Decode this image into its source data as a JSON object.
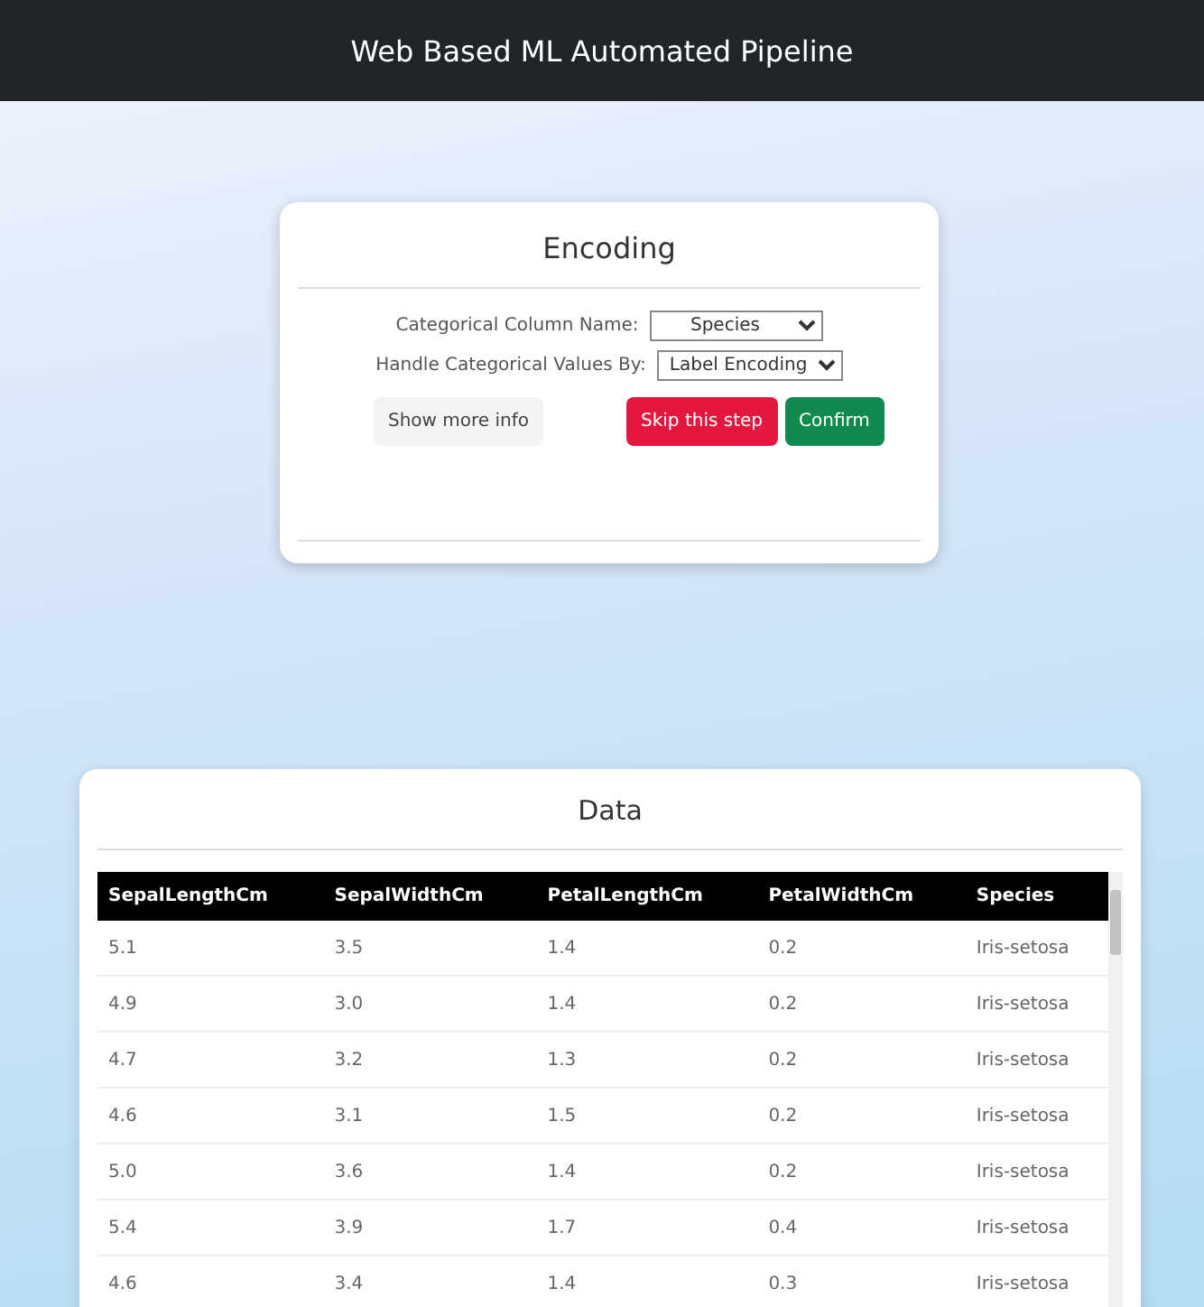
{
  "header": {
    "title": "Web Based ML Automated Pipeline"
  },
  "encoding_card": {
    "title": "Encoding",
    "fields": [
      {
        "label": "Categorical Column Name:",
        "value": "Species"
      },
      {
        "label": "Handle Categorical Values By:",
        "value": "Label Encoding"
      }
    ],
    "buttons": [
      {
        "label": "Show more info",
        "kind": "light"
      },
      {
        "label": "Skip this step",
        "kind": "danger"
      },
      {
        "label": "Confirm",
        "kind": "success"
      }
    ]
  },
  "data_card": {
    "title": "Data",
    "table": {
      "columns": [
        "SepalLengthCm",
        "SepalWidthCm",
        "PetalLengthCm",
        "PetalWidthCm",
        "Species"
      ],
      "rows": [
        [
          "5.1",
          "3.5",
          "1.4",
          "0.2",
          "Iris-setosa"
        ],
        [
          "4.9",
          "3.0",
          "1.4",
          "0.2",
          "Iris-setosa"
        ],
        [
          "4.7",
          "3.2",
          "1.3",
          "0.2",
          "Iris-setosa"
        ],
        [
          "4.6",
          "3.1",
          "1.5",
          "0.2",
          "Iris-setosa"
        ],
        [
          "5.0",
          "3.6",
          "1.4",
          "0.2",
          "Iris-setosa"
        ],
        [
          "5.4",
          "3.9",
          "1.7",
          "0.4",
          "Iris-setosa"
        ],
        [
          "4.6",
          "3.4",
          "1.4",
          "0.3",
          "Iris-setosa"
        ]
      ]
    }
  }
}
